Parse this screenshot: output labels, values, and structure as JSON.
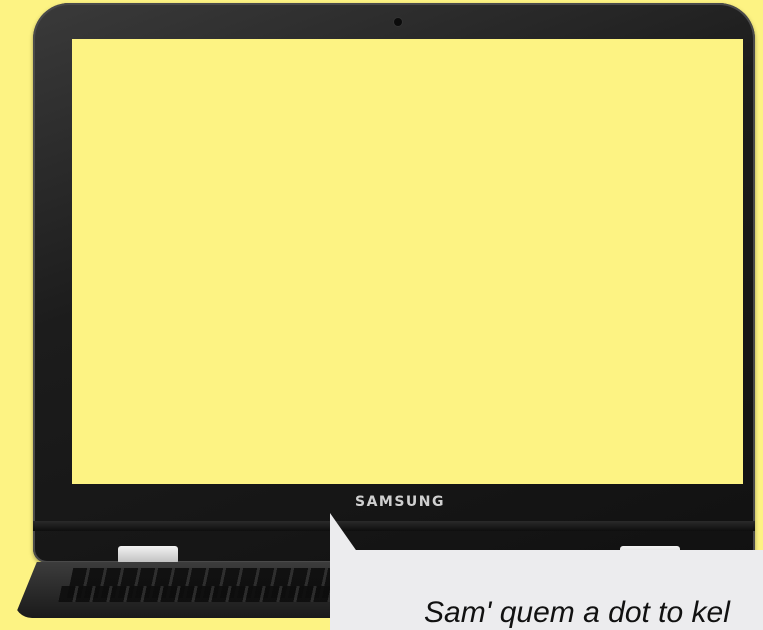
{
  "device": {
    "brand": "SAMSUNG",
    "screen_color": "#fdf383",
    "background_color": "#fdf383"
  },
  "callout": {
    "text": "Sam' quem a dot to kel"
  }
}
